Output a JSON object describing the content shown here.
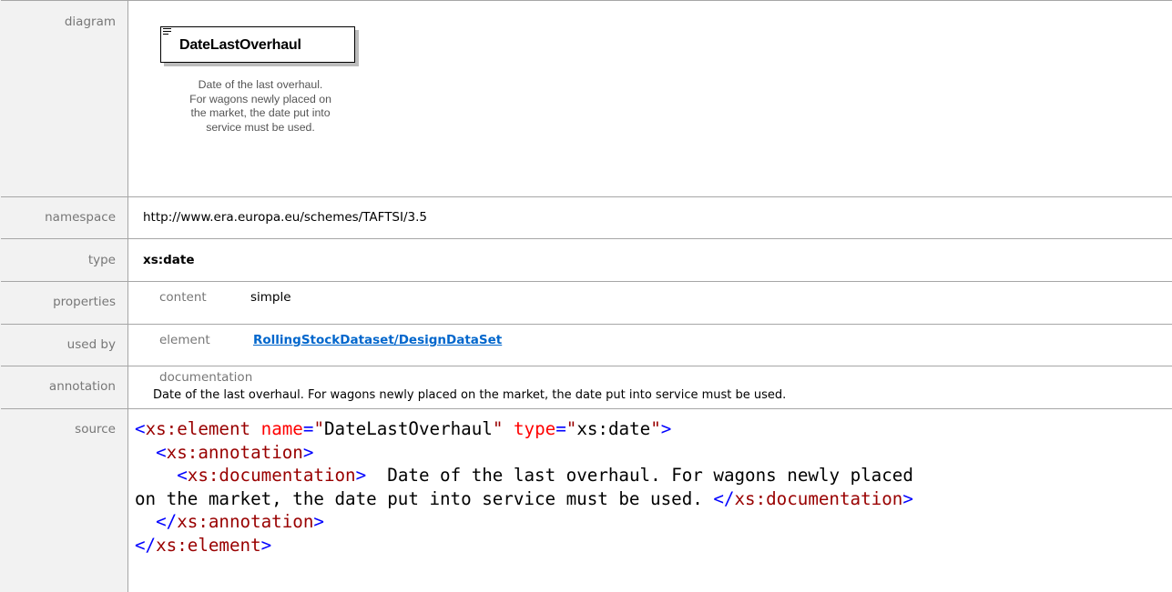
{
  "rows": {
    "diagram": {
      "label": "diagram",
      "element_name": "DateLastOverhaul",
      "doc_lines": [
        "Date of the last overhaul.",
        "For wagons newly placed on",
        "the market, the date put into",
        "service must be used."
      ]
    },
    "namespace": {
      "label": "namespace",
      "value": "http://www.era.europa.eu/schemes/TAFTSI/3.5"
    },
    "type": {
      "label": "type",
      "value": "xs:date"
    },
    "properties": {
      "label": "properties",
      "key": "content",
      "value": "simple"
    },
    "used_by": {
      "label": "used by",
      "key": "element",
      "link": "RollingStockDataset/DesignDataSet"
    },
    "annotation": {
      "label": "annotation",
      "key": "documentation",
      "value": "Date of the last overhaul. For wagons newly placed on the market, the date put into service must be used."
    },
    "source": {
      "label": "source",
      "line1": {
        "open": "<",
        "tag": "xs:element",
        "attr1": "name",
        "val1": "DateLastOverhaul",
        "attr2": "type",
        "val2": "xs:date",
        "close": ">"
      },
      "line2": {
        "open": "<",
        "tag": "xs:annotation",
        "close": ">"
      },
      "line3": {
        "open": "<",
        "tag": "xs:documentation",
        "close": ">",
        "text": "  Date of the last overhaul. For wagons newly placed"
      },
      "line4": {
        "text": "on the market, the date put into service must be used. ",
        "open": "</",
        "tag": "xs:documentation",
        "close": ">"
      },
      "line5": {
        "open": "</",
        "tag": "xs:annotation",
        "close": ">"
      },
      "line6": {
        "open": "</",
        "tag": "xs:element",
        "close": ">"
      }
    }
  }
}
